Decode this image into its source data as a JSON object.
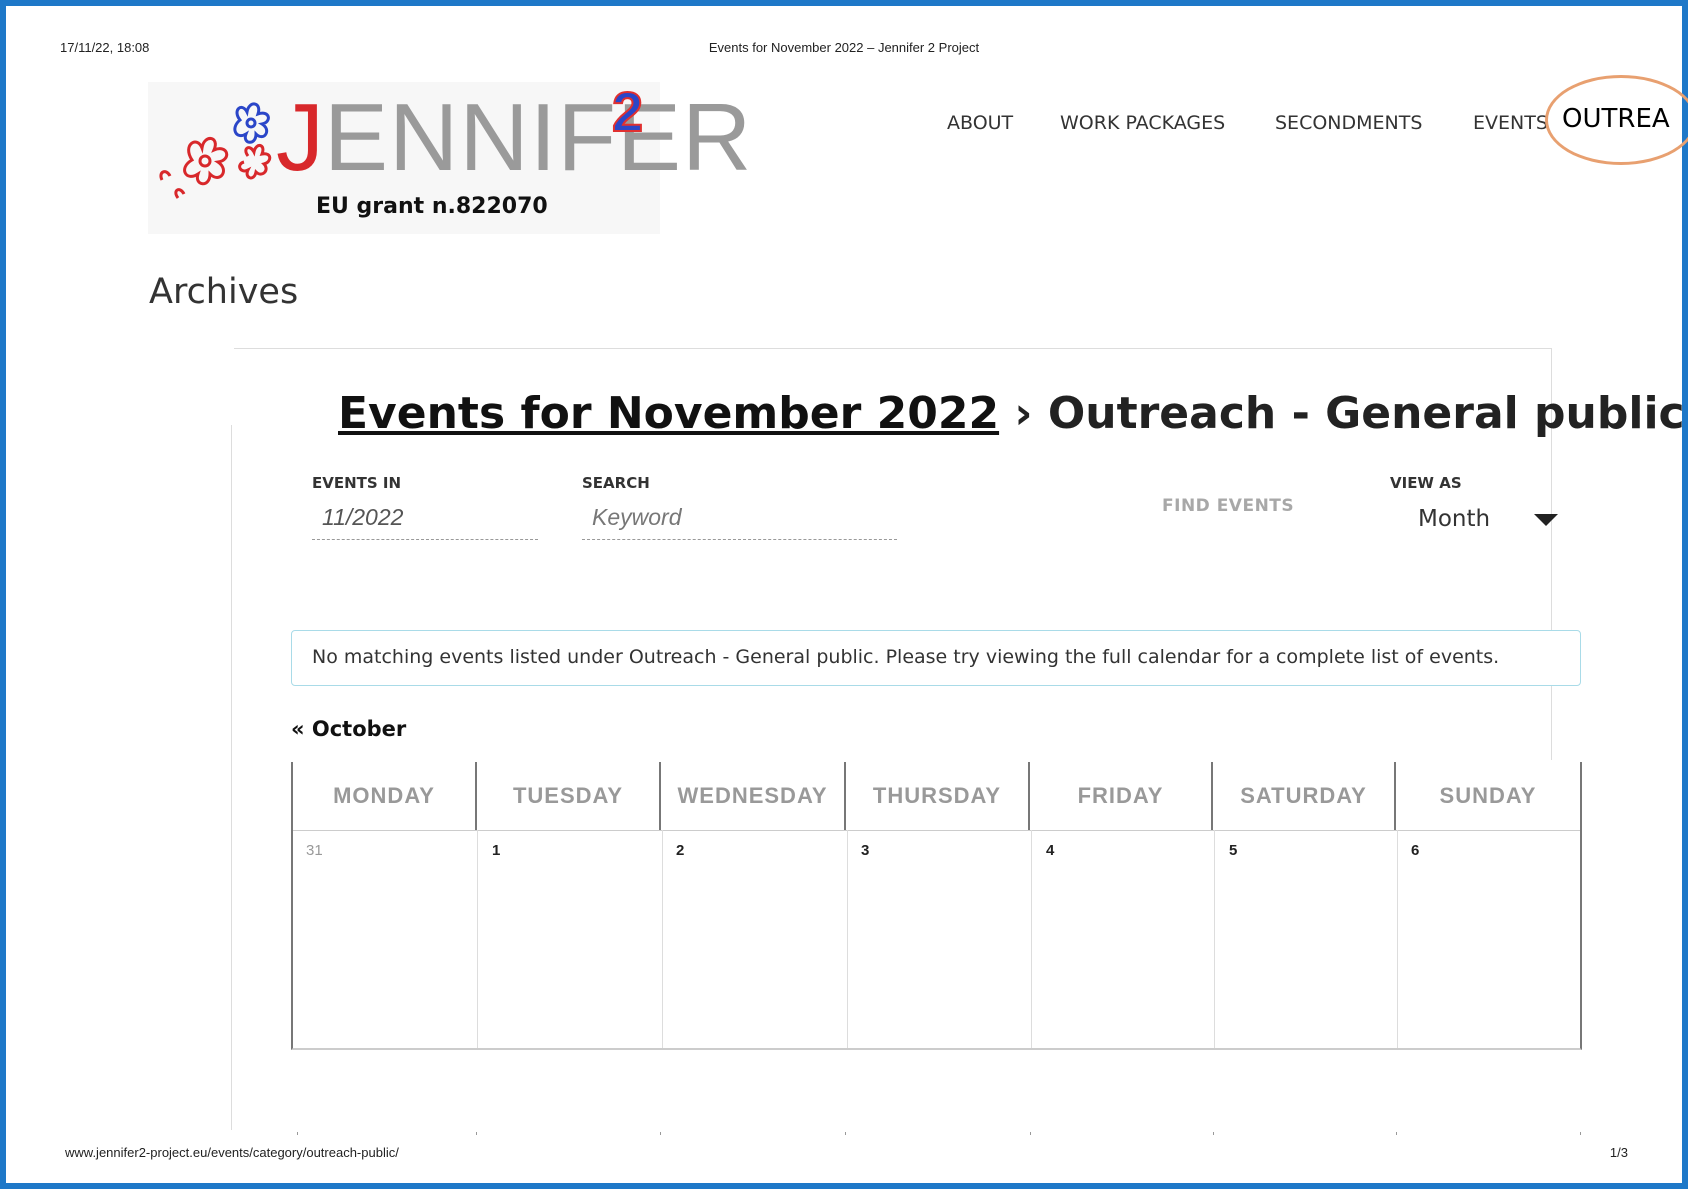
{
  "print_header": {
    "datetime": "17/11/22, 18:08",
    "page_title": "Events for November 2022 – Jennifer 2 Project"
  },
  "logo": {
    "letter_j": "J",
    "letters_rest": "ENNIFER",
    "superscript": "2",
    "grant": "EU grant n.822070"
  },
  "nav": {
    "items": [
      {
        "label": "ABOUT"
      },
      {
        "label": "WORK PACKAGES"
      },
      {
        "label": "SECONDMENTS"
      },
      {
        "label": "EVENTS"
      }
    ],
    "outreach_label": "OUTREA"
  },
  "archives_heading": "Archives",
  "events_title": {
    "link_text": "Events for November 2022",
    "rest": " › Outreach - General public"
  },
  "filter_bar": {
    "events_in_label": "EVENTS IN",
    "events_in_value": "11/2022",
    "search_label": "SEARCH",
    "search_placeholder": "Keyword",
    "find_button": "FIND EVENTS",
    "view_as_label": "VIEW AS",
    "view_as_value": "Month"
  },
  "notice": "No matching events listed under Outreach - General public. Please try viewing the full calendar for a complete list of events.",
  "prev_month_link": "« October",
  "calendar": {
    "days": [
      "MONDAY",
      "TUESDAY",
      "WEDNESDAY",
      "THURSDAY",
      "FRIDAY",
      "SATURDAY",
      "SUNDAY"
    ],
    "first_week": [
      "31",
      "1",
      "2",
      "3",
      "4",
      "5",
      "6"
    ]
  },
  "print_footer": {
    "url": "www.jennifer2-project.eu/events/category/outreach-public/",
    "page": "1/3"
  },
  "colors": {
    "frame": "#1e78c8",
    "logo_j": "#d8282b",
    "logo_superscript": "#2b46c8",
    "outreach_highlight": "#e8a070",
    "notice_border": "#a9dbe8"
  }
}
